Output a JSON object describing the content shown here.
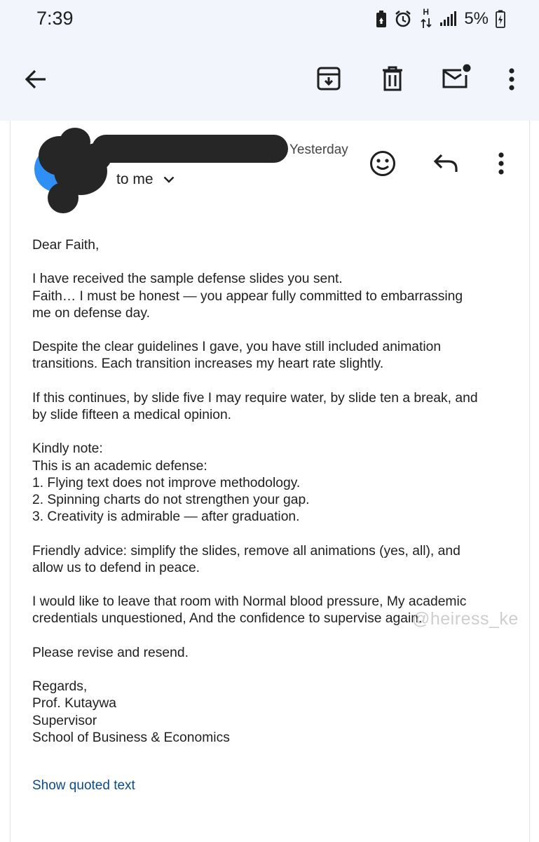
{
  "status_bar": {
    "time": "7:39",
    "network_label": "H",
    "battery_percent": "5%",
    "icons": [
      "recycle-battery-icon",
      "alarm-icon",
      "data-arrows-icon",
      "signal-icon",
      "battery-charging-icon"
    ]
  },
  "toolbar": {
    "actions": [
      "back-arrow-icon",
      "archive-icon",
      "delete-icon",
      "mark-unread-icon",
      "more-vert-icon"
    ]
  },
  "email": {
    "sender_name_redacted": true,
    "time": "Yesterday",
    "recipient_label": "to me",
    "header_actions": [
      "emoji-react-icon",
      "reply-icon",
      "more-vert-icon"
    ],
    "paragraphs": [
      [
        "Dear Faith,"
      ],
      [
        "I have received the sample defense slides you sent.",
        "Faith… I must be honest — you appear fully committed to embarrassing",
        "me on defense day."
      ],
      [
        "Despite the clear guidelines I gave, you have still included animation",
        "transitions. Each transition increases my heart rate slightly."
      ],
      [
        "If this continues, by slide five I may require water, by slide ten a break, and",
        "by slide fifteen a medical opinion."
      ],
      [
        "Kindly note:",
        "This is an academic defense:",
        "1. Flying text does not improve methodology.",
        "2. Spinning charts do not strengthen your gap.",
        "3. Creativity is admirable — after graduation."
      ],
      [
        "Friendly advice: simplify the slides, remove all animations (yes, all), and",
        "allow us to defend in peace."
      ],
      [
        "I would like to leave that room with Normal blood pressure, My academic",
        "credentials unquestioned, And the confidence to supervise again."
      ],
      [
        "Please revise and resend."
      ],
      [
        "Regards,",
        "Prof. Kutaywa",
        "Supervisor",
        "School of Business & Economics"
      ]
    ],
    "show_quoted_label": "Show quoted text"
  },
  "watermark_text": "@heiress_ke",
  "colors": {
    "top_background": "#f2f6fc",
    "link": "#0b4a8b",
    "avatar": "#2f8ff5",
    "redaction": "#262626"
  }
}
